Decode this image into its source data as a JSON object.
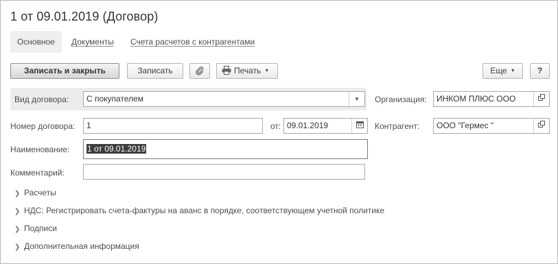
{
  "window": {
    "title": "1 от 09.01.2019 (Договор)"
  },
  "tabs": [
    {
      "label": "Основное",
      "active": true
    },
    {
      "label": "Документы",
      "active": false
    },
    {
      "label": "Счета расчетов с контрагентами",
      "active": false
    }
  ],
  "toolbar": {
    "save_close_label": "Записать и закрыть",
    "save_label": "Записать",
    "attach_icon": "paperclip-icon",
    "print_label": "Печать",
    "print_icon": "printer-icon",
    "more_label": "Еще",
    "help_label": "?"
  },
  "form": {
    "contract_type": {
      "label": "Вид договора:",
      "value": "С покупателем"
    },
    "organization": {
      "label": "Организация:",
      "value": "ИНКОМ ПЛЮС ООО"
    },
    "contract_number": {
      "label": "Номер договора:",
      "value": "1"
    },
    "date": {
      "label": "от:",
      "value": "09.01.2019"
    },
    "counterparty": {
      "label": "Контрагент:",
      "value": "ООО \"Гермес \""
    },
    "name": {
      "label": "Наименование:",
      "value": "1 от 09.01.2019"
    },
    "comment": {
      "label": "Комментарий:",
      "value": ""
    }
  },
  "sections": [
    {
      "label": "Расчеты"
    },
    {
      "label": "НДС: Регистрировать счета-фактуры на аванс в порядке, соответствующем учетной политике"
    },
    {
      "label": "Подписи"
    },
    {
      "label": "Дополнительная информация"
    }
  ],
  "colors": {
    "highlight_row": "#ececec",
    "selection": "#3d3d3d",
    "border": "#a9a9a9"
  }
}
